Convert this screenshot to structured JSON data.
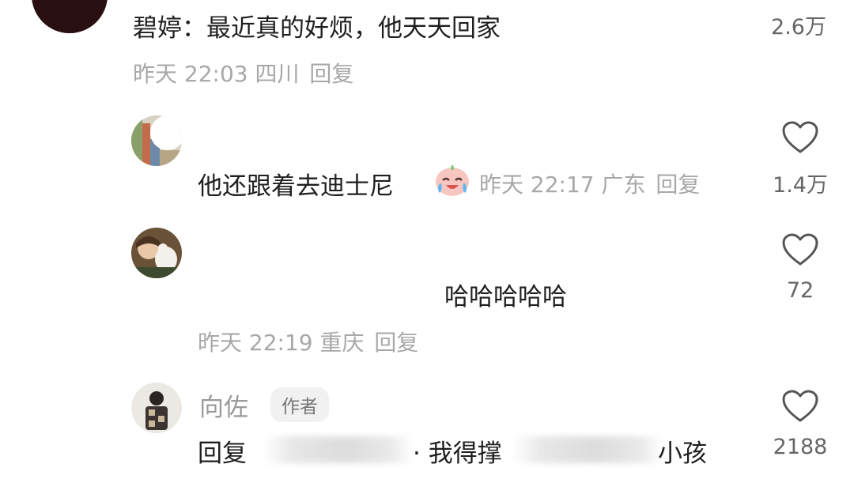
{
  "top_comment": {
    "text": "碧婷：最近真的好烦，他天天回家",
    "likes": "2.6万",
    "date": "昨天 22:03",
    "location": "四川",
    "reply_label": "回复"
  },
  "replies": [
    {
      "text": "他还跟着去迪士尼",
      "emoji": "crying-laughing-emoji",
      "date": "昨天 22:17",
      "location": "广东",
      "reply_label": "回复",
      "likes": "1.4万"
    },
    {
      "text": "哈哈哈哈哈",
      "date": "昨天 22:19",
      "location": "重庆",
      "reply_label": "回复",
      "likes": "72"
    },
    {
      "author": "向佐",
      "author_badge": "作者",
      "reply_prefix": "回复",
      "text_part1": "· 我得撑",
      "text_part2": "小孩",
      "likes": "2188"
    }
  ],
  "icons": {
    "like": "heart-outline-icon"
  },
  "colors": {
    "primary_text": "#1f1f1f",
    "secondary_text": "#a8a8a8",
    "badge_bg": "#f1f1f1"
  }
}
